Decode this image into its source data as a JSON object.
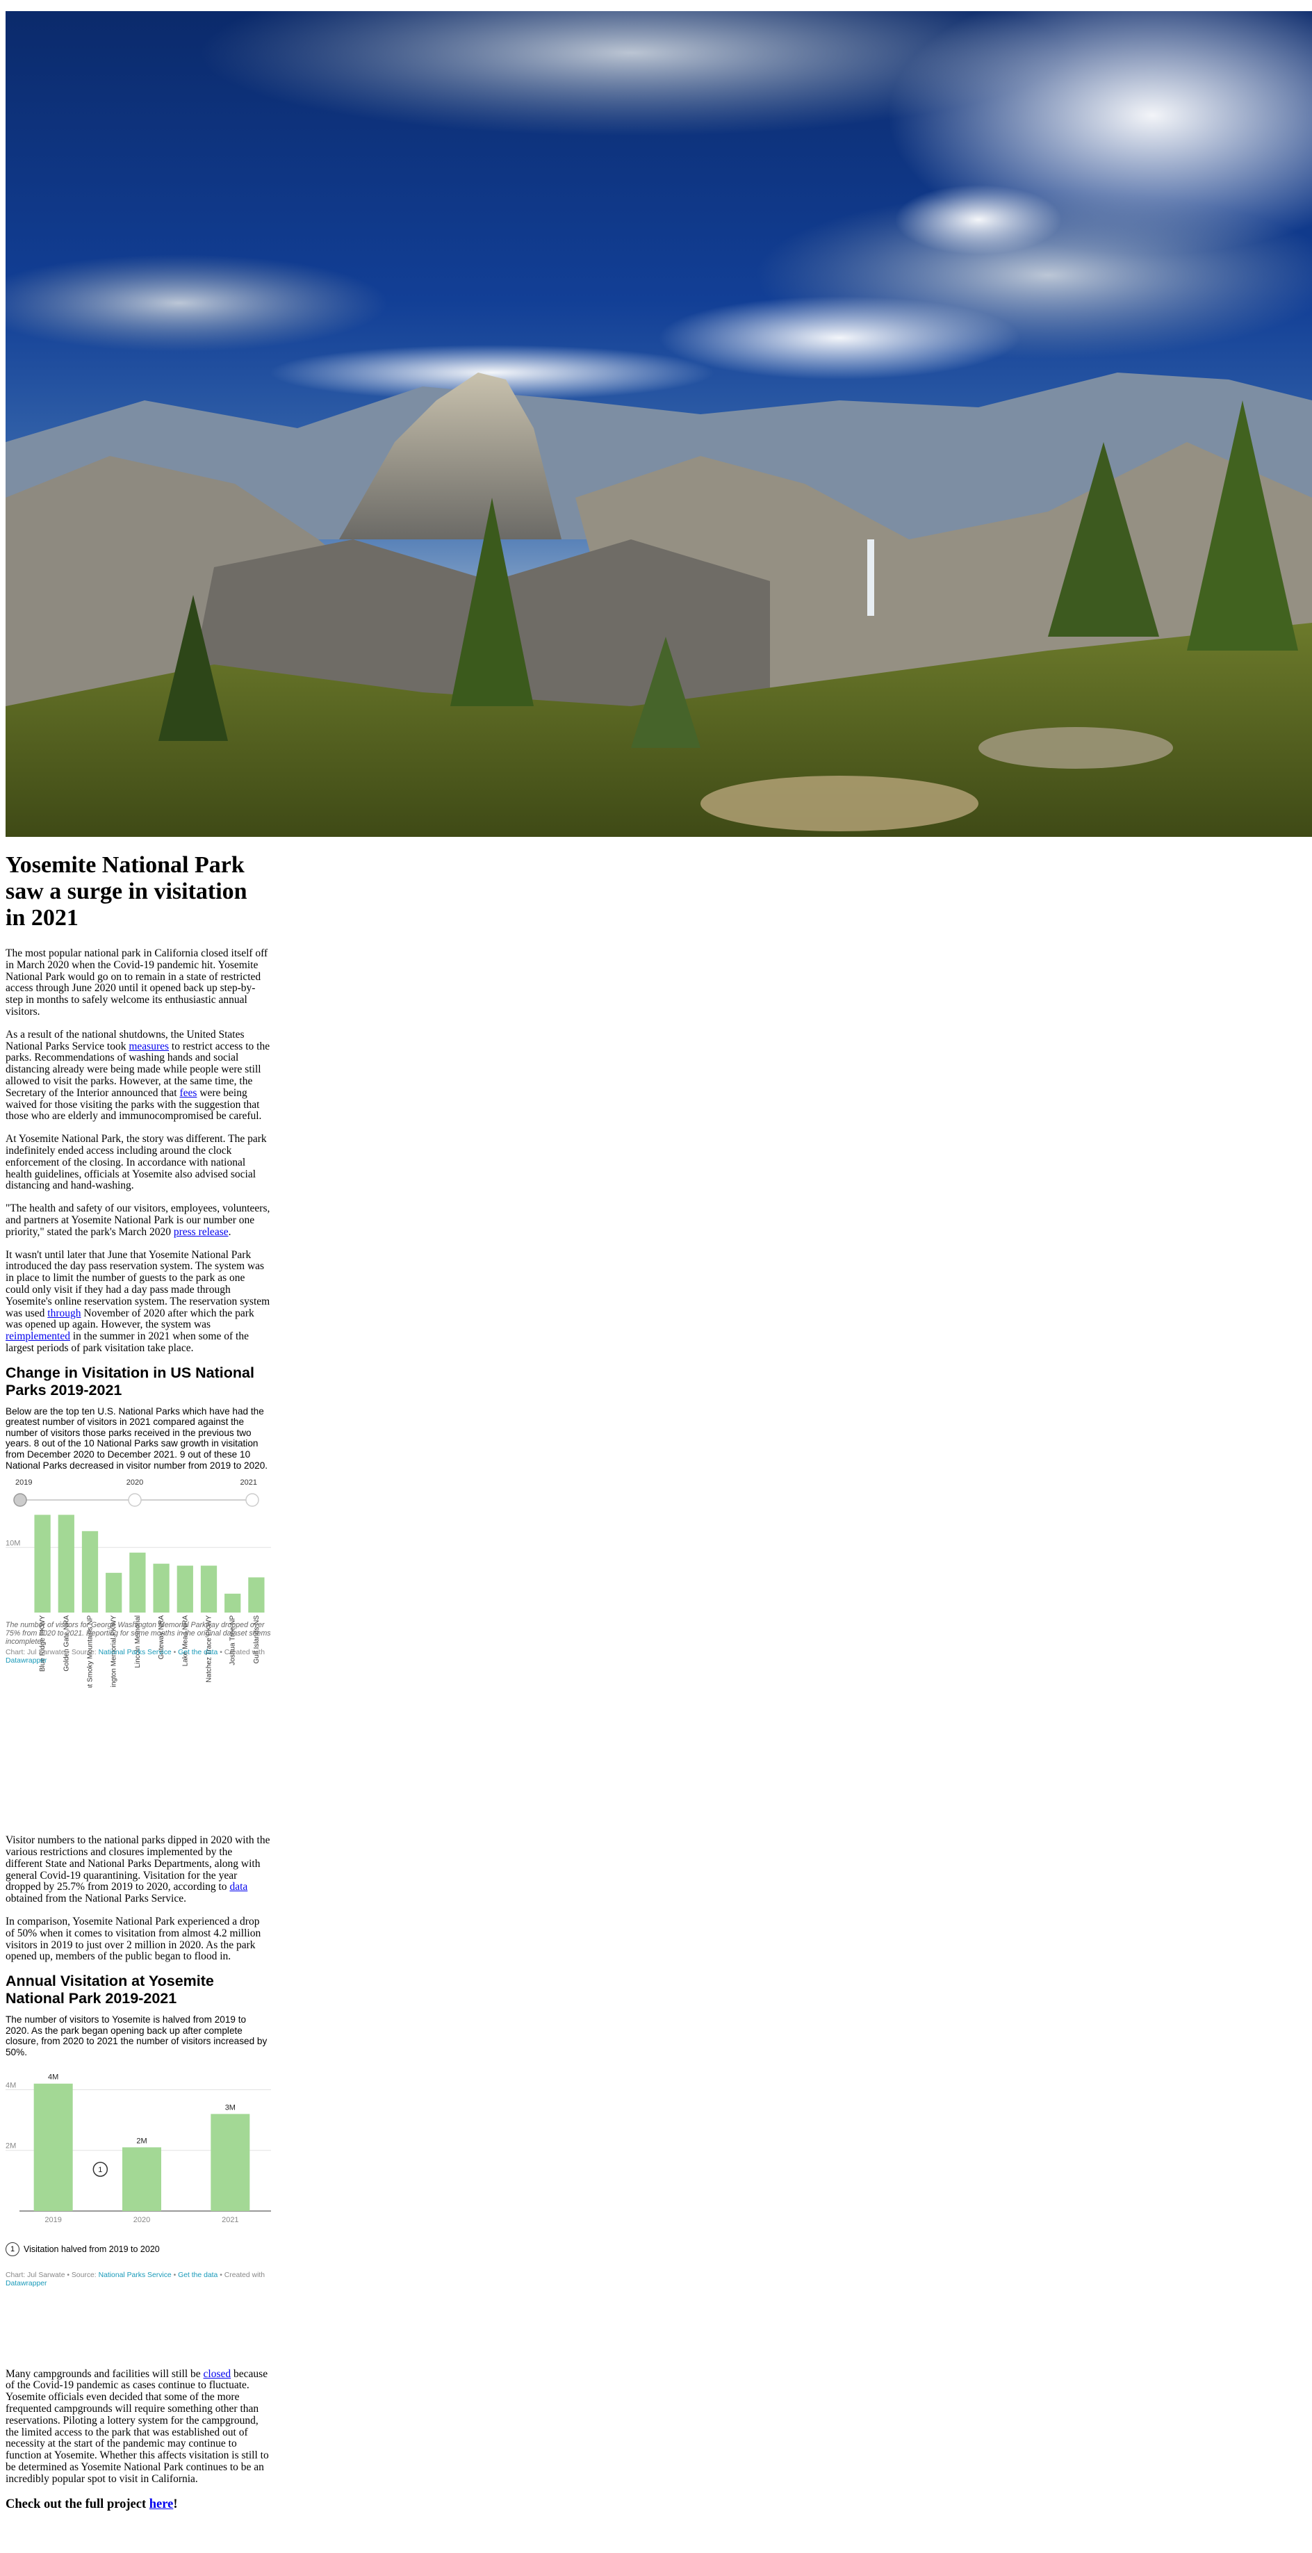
{
  "hero": {
    "alt": "Yosemite valley with Half Dome under dramatic clouds"
  },
  "article": {
    "title": "Yosemite National Park saw a surge in visitation in 2021",
    "p1": "The most popular national park in California closed itself off in March 2020 when the Covid-19 pandemic hit. Yosemite National Park would go on to remain in a state of restricted access through June 2020 until it opened back up step-by-step in months to safely welcome its enthusiastic annual visitors.",
    "p2": {
      "a": "As a result of the national shutdowns, the United States National Parks Service took ",
      "link1": "measures",
      "b": " to restrict access to the parks. Recommendations of washing hands and social distancing already were being made while people were still allowed to visit the parks. However, at the same time, the Secretary of the Interior announced that ",
      "link2": "fees",
      "c": " were being waived for those visiting the parks with the suggestion that those who are elderly and immunocompromised be careful."
    },
    "p3": "At Yosemite National Park, the story was different. The park indefinitely ended access including around the clock enforcement of the closing. In accordance with national health guidelines, officials at Yosemite also advised social distancing and hand-washing.",
    "p4": {
      "a": "\"The health and safety of our visitors, employees, volunteers, and partners at Yosemite National Park is our number one priority,\" stated the park's March 2020 ",
      "link": "press release",
      "b": "."
    },
    "p5": {
      "a": "It wasn't until later that June that Yosemite National Park introduced the day pass reservation system. The system was in place to limit the number of guests to the park as one could only visit if they had a day pass made through Yosemite's online reservation system. The reservation system was used ",
      "link1": "through",
      "b": " November of 2020 after which the park was opened up again. However, the system was ",
      "link2": "reimplemented",
      "c": " in the summer in 2021 when some of the largest periods of park visitation take place."
    },
    "p6": "Visitor numbers to the national parks dipped in 2020 with the various restrictions and closures implemented by the different State and National Parks Departments, along with general Covid-19 quarantining. Visitation for the year dropped by 25.7% from 2019 to 2020, according to ",
    "p6_link": "data",
    "p6_end": " obtained from the National Parks Service.",
    "p7": "In comparison, Yosemite National Park experienced a drop of 50% when it comes to visitation from almost 4.2 million visitors in 2019 to just over 2 million in 2020. As the park opened up, members of the public began to flood in.",
    "p8": {
      "a": "Many campgrounds and facilities will still be ",
      "link": "closed",
      "b": " because of the Covid-19 pandemic as cases continue to fluctuate. Yosemite officials even decided that some of the more frequented campgrounds will require something other than reservations. Piloting a lottery system for the campground, the limited access to the park that was established out of necessity at the start of the pandemic may continue to function at Yosemite. Whether this affects visitation is still to be determined as Yosemite National Park continues to be an incredibly popular spot to visit in California."
    },
    "footer": {
      "a": "Check out the full project ",
      "link": "here",
      "b": "!"
    }
  },
  "chart1": {
    "title": "Change in Visitation in US National Parks 2019-2021",
    "description": "Below are the top ten U.S. National Parks which have had the greatest number of visitors in 2021 compared against the number of visitors those parks received in the previous two years. 8 out of the 10 National Parks saw growth in visitation from December 2020 to December 2021. 9 out of these 10 National Parks decreased in visitor number from 2019 to 2020.",
    "note": "The number of visitors for George Washington Memorial Parkway dropped over 75% from 2020 to 2021. Reporting for some months in the original dataset seems incomplete.",
    "credit": {
      "a": "Chart: Jul Sarwate • Source: ",
      "source": "National Parks Service",
      "sep": " • ",
      "getdata": "Get the data",
      "b": " • Created with ",
      "tool": "Datawrapper"
    }
  },
  "chart2": {
    "title": "Annual Visitation at Yosemite National Park 2019-2021",
    "description": "The number of visitors to Yosemite is halved from 2019 to 2020. As the park began opening back up after complete closure, from 2020 to 2021 the number of visitors increased by 50%.",
    "annotation_number": "1",
    "annotation_text": "Visitation halved from 2019 to 2020",
    "credit": {
      "a": "Chart: Jul Sarwate • Source: ",
      "source": "National Parks Service",
      "sep": " • ",
      "getdata": "Get the data",
      "b": " • Created with ",
      "tool": "Datawrapper"
    }
  },
  "chart_data": [
    {
      "type": "bar",
      "title": "Change in Visitation in US National Parks 2019-2021",
      "slider_years": [
        "2019",
        "2020",
        "2021"
      ],
      "selected_year": "2019",
      "categories": [
        "Blue Ridge PKWY",
        "Golden Gate NRA",
        "Great Smoky Mountains NP",
        "George Washington Memorial PKWY",
        "Lincoln Memorial",
        "Gateway NRA",
        "Lake Mead NRA",
        "Natchez Trace PKWY",
        "Joshua Tree NP",
        "Gulf Islands NS"
      ],
      "values": [
        15.0,
        15.0,
        12.5,
        6.1,
        9.2,
        7.5,
        7.2,
        7.2,
        2.9,
        5.4
      ],
      "ylim": [
        0,
        16
      ],
      "yticks": [
        {
          "value": 10,
          "label": "10M"
        }
      ],
      "color": "#a3d895",
      "grid": true
    },
    {
      "type": "bar",
      "title": "Annual Visitation at Yosemite National Park 2019-2021",
      "categories": [
        "2019",
        "2020",
        "2021"
      ],
      "values": [
        4.2,
        2.1,
        3.2
      ],
      "data_labels": [
        "4M",
        "2M",
        "3M"
      ],
      "ylim": [
        0,
        4.4
      ],
      "yticks": [
        {
          "value": 2,
          "label": "2M"
        },
        {
          "value": 4,
          "label": "4M"
        }
      ],
      "color": "#a3d895",
      "grid": true
    }
  ]
}
